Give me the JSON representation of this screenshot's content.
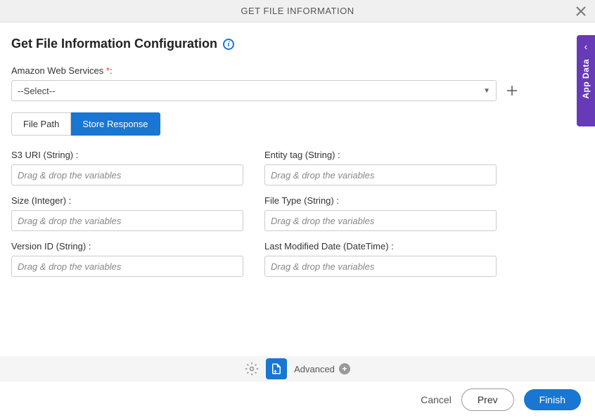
{
  "header": {
    "title": "GET FILE INFORMATION"
  },
  "page": {
    "title": "Get File Information Configuration"
  },
  "aws": {
    "label": "Amazon Web Services ",
    "select_text": "--Select--"
  },
  "tabs": {
    "file_path": "File Path",
    "store_response": "Store Response"
  },
  "fields": {
    "s3_uri": {
      "label": "S3 URI (String) :",
      "placeholder": "Drag & drop the variables"
    },
    "entity_tag": {
      "label": "Entity tag (String) :",
      "placeholder": "Drag & drop the variables"
    },
    "size": {
      "label": "Size (Integer) :",
      "placeholder": "Drag & drop the variables"
    },
    "file_type": {
      "label": "File Type (String) :",
      "placeholder": "Drag & drop the variables"
    },
    "version_id": {
      "label": "Version ID (String) :",
      "placeholder": "Drag & drop the variables"
    },
    "last_modified": {
      "label": "Last Modified Date (DateTime) :",
      "placeholder": "Drag & drop the variables"
    }
  },
  "toolbar": {
    "advanced": "Advanced"
  },
  "footer": {
    "cancel": "Cancel",
    "prev": "Prev",
    "finish": "Finish"
  },
  "side": {
    "label": "App Data"
  }
}
